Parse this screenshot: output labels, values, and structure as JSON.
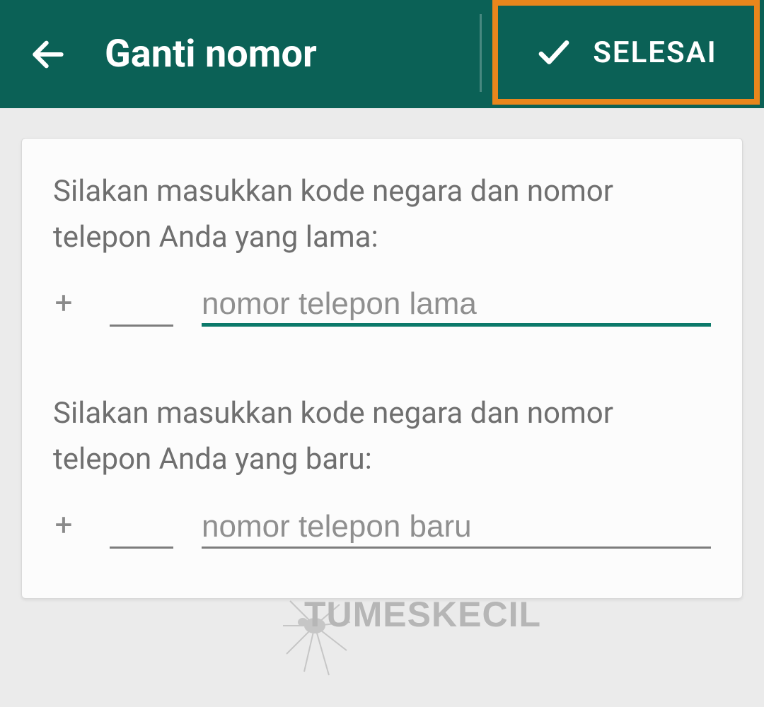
{
  "colors": {
    "primary": "#0b6156",
    "accent": "#0c796a",
    "highlight_border": "#e8861c"
  },
  "appbar": {
    "title": "Ganti nomor",
    "done_label": "SELESAI"
  },
  "form": {
    "old": {
      "label": "Silakan masukkan kode negara dan nomor telepon Anda yang lama:",
      "cc_prefix": "+",
      "cc_value": "",
      "phone_value": "",
      "phone_placeholder": "nomor telepon lama"
    },
    "new": {
      "label": "Silakan masukkan kode negara dan nomor telepon Anda yang baru:",
      "cc_prefix": "+",
      "cc_value": "",
      "phone_value": "",
      "phone_placeholder": "nomor telepon baru"
    }
  },
  "watermark": {
    "text": "TUMESKECIL"
  }
}
